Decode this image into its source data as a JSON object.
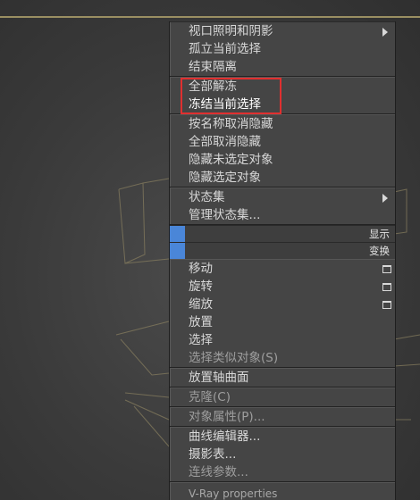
{
  "menu": {
    "lighting": "视口照明和阴影",
    "isolate": "孤立当前选择",
    "end_isolate": "结束隔离",
    "unfreeze_all": "全部解冻",
    "freeze_selection": "冻结当前选择",
    "unhide_by_name": "按名称取消隐藏",
    "unhide_all": "全部取消隐藏",
    "hide_unselected": "隐藏未选定对象",
    "hide_selection": "隐藏选定对象",
    "state_sets": "状态集",
    "manage_state_sets": "管理状态集...",
    "display_header": "显示",
    "transform_header": "变换",
    "move": "移动",
    "rotate": "旋转",
    "scale": "缩放",
    "place": "放置",
    "select": "选择",
    "select_similar": "选择类似对象(S)",
    "place_pivot_surface": "放置轴曲面",
    "clone": "克隆(C)",
    "object_properties": "对象属性(P)...",
    "curve_editor": "曲线编辑器...",
    "dope_sheet": "摄影表...",
    "wire_params": "连线参数...",
    "vray_properties": "V-Ray properties"
  },
  "colors": {
    "menu_bg": "#454545",
    "highlight_box": "#e03030",
    "quad_swatch": "#4a86d8"
  }
}
